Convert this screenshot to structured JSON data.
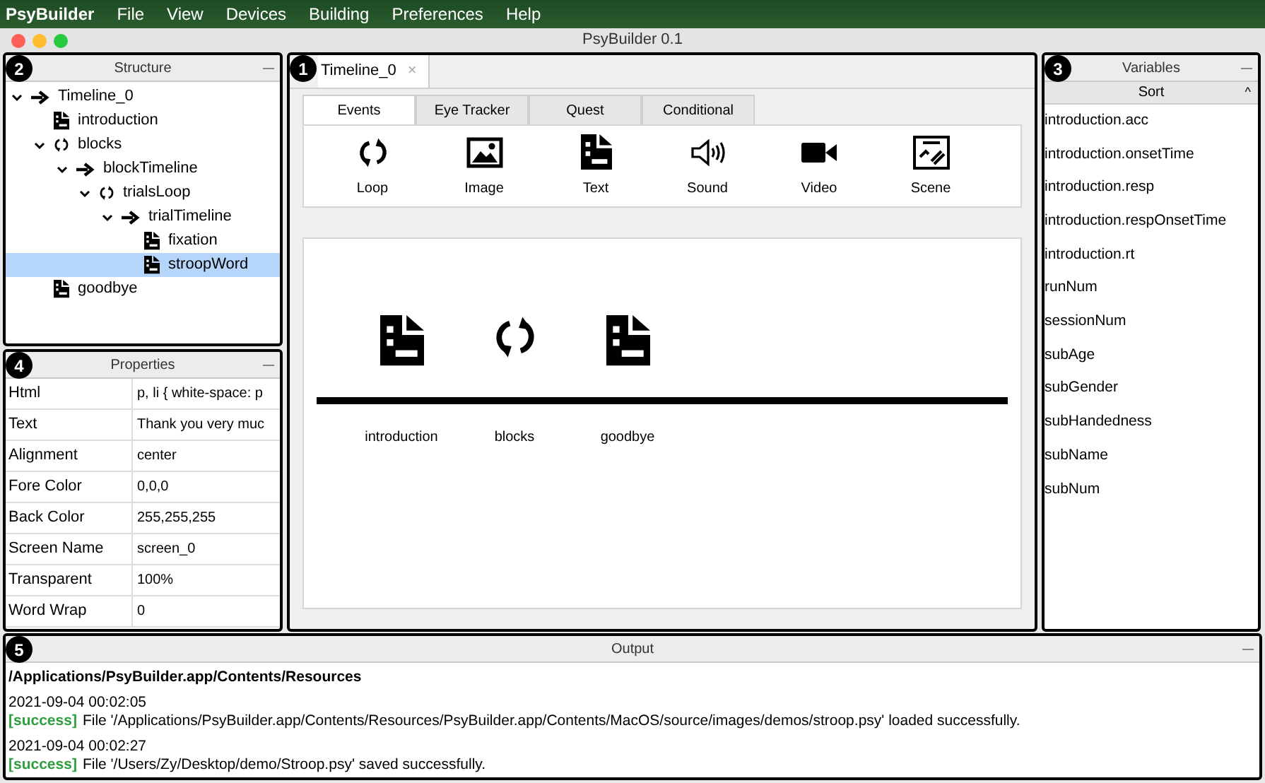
{
  "menu_bar": {
    "app_name": "PsyBuilder",
    "items": [
      "File",
      "View",
      "Devices",
      "Building",
      "Preferences",
      "Help"
    ]
  },
  "window": {
    "title": "PsyBuilder 0.1"
  },
  "structure": {
    "badge": "2",
    "title": "Structure",
    "tree": [
      {
        "label": "Timeline_0",
        "kind": "timeline",
        "expanded": true,
        "selected": false,
        "children": [
          {
            "label": "introduction",
            "kind": "text",
            "selected": false
          },
          {
            "label": "blocks",
            "kind": "loop",
            "expanded": true,
            "selected": false,
            "children": [
              {
                "label": "blockTimeline",
                "kind": "timeline",
                "expanded": true,
                "selected": false,
                "children": [
                  {
                    "label": "trialsLoop",
                    "kind": "loop",
                    "expanded": true,
                    "selected": false,
                    "children": [
                      {
                        "label": "trialTimeline",
                        "kind": "timeline",
                        "expanded": true,
                        "selected": false,
                        "children": [
                          {
                            "label": "fixation",
                            "kind": "text",
                            "selected": false
                          },
                          {
                            "label": "stroopWord",
                            "kind": "text",
                            "selected": true
                          }
                        ]
                      }
                    ]
                  }
                ]
              }
            ]
          },
          {
            "label": "goodbye",
            "kind": "text",
            "selected": false
          }
        ]
      }
    ]
  },
  "properties": {
    "badge": "4",
    "title": "Properties",
    "rows": [
      {
        "name": "Html",
        "value": "p, li { white-space: p"
      },
      {
        "name": "Text",
        "value": "Thank you very muc"
      },
      {
        "name": "Alignment",
        "value": "center"
      },
      {
        "name": "Fore Color",
        "value": "0,0,0"
      },
      {
        "name": "Back Color",
        "value": "255,255,255"
      },
      {
        "name": "Screen Name",
        "value": "screen_0"
      },
      {
        "name": "Transparent",
        "value": "100%"
      },
      {
        "name": "Word Wrap",
        "value": "0"
      }
    ]
  },
  "editor": {
    "badge": "1",
    "doc_tab": {
      "label": "Timeline_0",
      "close": "×"
    },
    "tabs": [
      {
        "label": "Events",
        "selected": true
      },
      {
        "label": "Eye Tracker",
        "selected": false
      },
      {
        "label": "Quest",
        "selected": false
      },
      {
        "label": "Conditional",
        "selected": false
      }
    ],
    "events": [
      {
        "label": "Loop",
        "kind": "loop"
      },
      {
        "label": "Image",
        "kind": "image"
      },
      {
        "label": "Text",
        "kind": "text"
      },
      {
        "label": "Sound",
        "kind": "sound"
      },
      {
        "label": "Video",
        "kind": "video"
      },
      {
        "label": "Scene",
        "kind": "scene"
      }
    ],
    "timeline": [
      {
        "label": "introduction",
        "kind": "text"
      },
      {
        "label": "blocks",
        "kind": "loop"
      },
      {
        "label": "goodbye",
        "kind": "text"
      }
    ]
  },
  "variables": {
    "badge": "3",
    "title": "Variables",
    "sort_header": "Sort",
    "sort_arrow": "^",
    "items": [
      "introduction.acc",
      "introduction.onsetTime",
      "introduction.resp",
      "introduction.respOnsetTime",
      "introduction.rt",
      "runNum",
      "sessionNum",
      "subAge",
      "subGender",
      "subHandedness",
      "subName",
      "subNum"
    ]
  },
  "output": {
    "badge": "5",
    "title": "Output",
    "lines": [
      {
        "kind": "path",
        "text": "/Applications/PsyBuilder.app/Contents/Resources"
      },
      {
        "kind": "time",
        "text": "2021-09-04 00:02:05"
      },
      {
        "kind": "message",
        "tag": "[success]",
        "text": "File '/Applications/PsyBuilder.app/Contents/Resources/PsyBuilder.app/Contents/MacOS/source/images/demos/stroop.psy' loaded successfully."
      },
      {
        "kind": "time",
        "text": "2021-09-04 00:02:27"
      },
      {
        "kind": "message",
        "tag": "[success]",
        "text": "File '/Users/Zy/Desktop/demo/Stroop.psy' saved successfully."
      }
    ]
  }
}
